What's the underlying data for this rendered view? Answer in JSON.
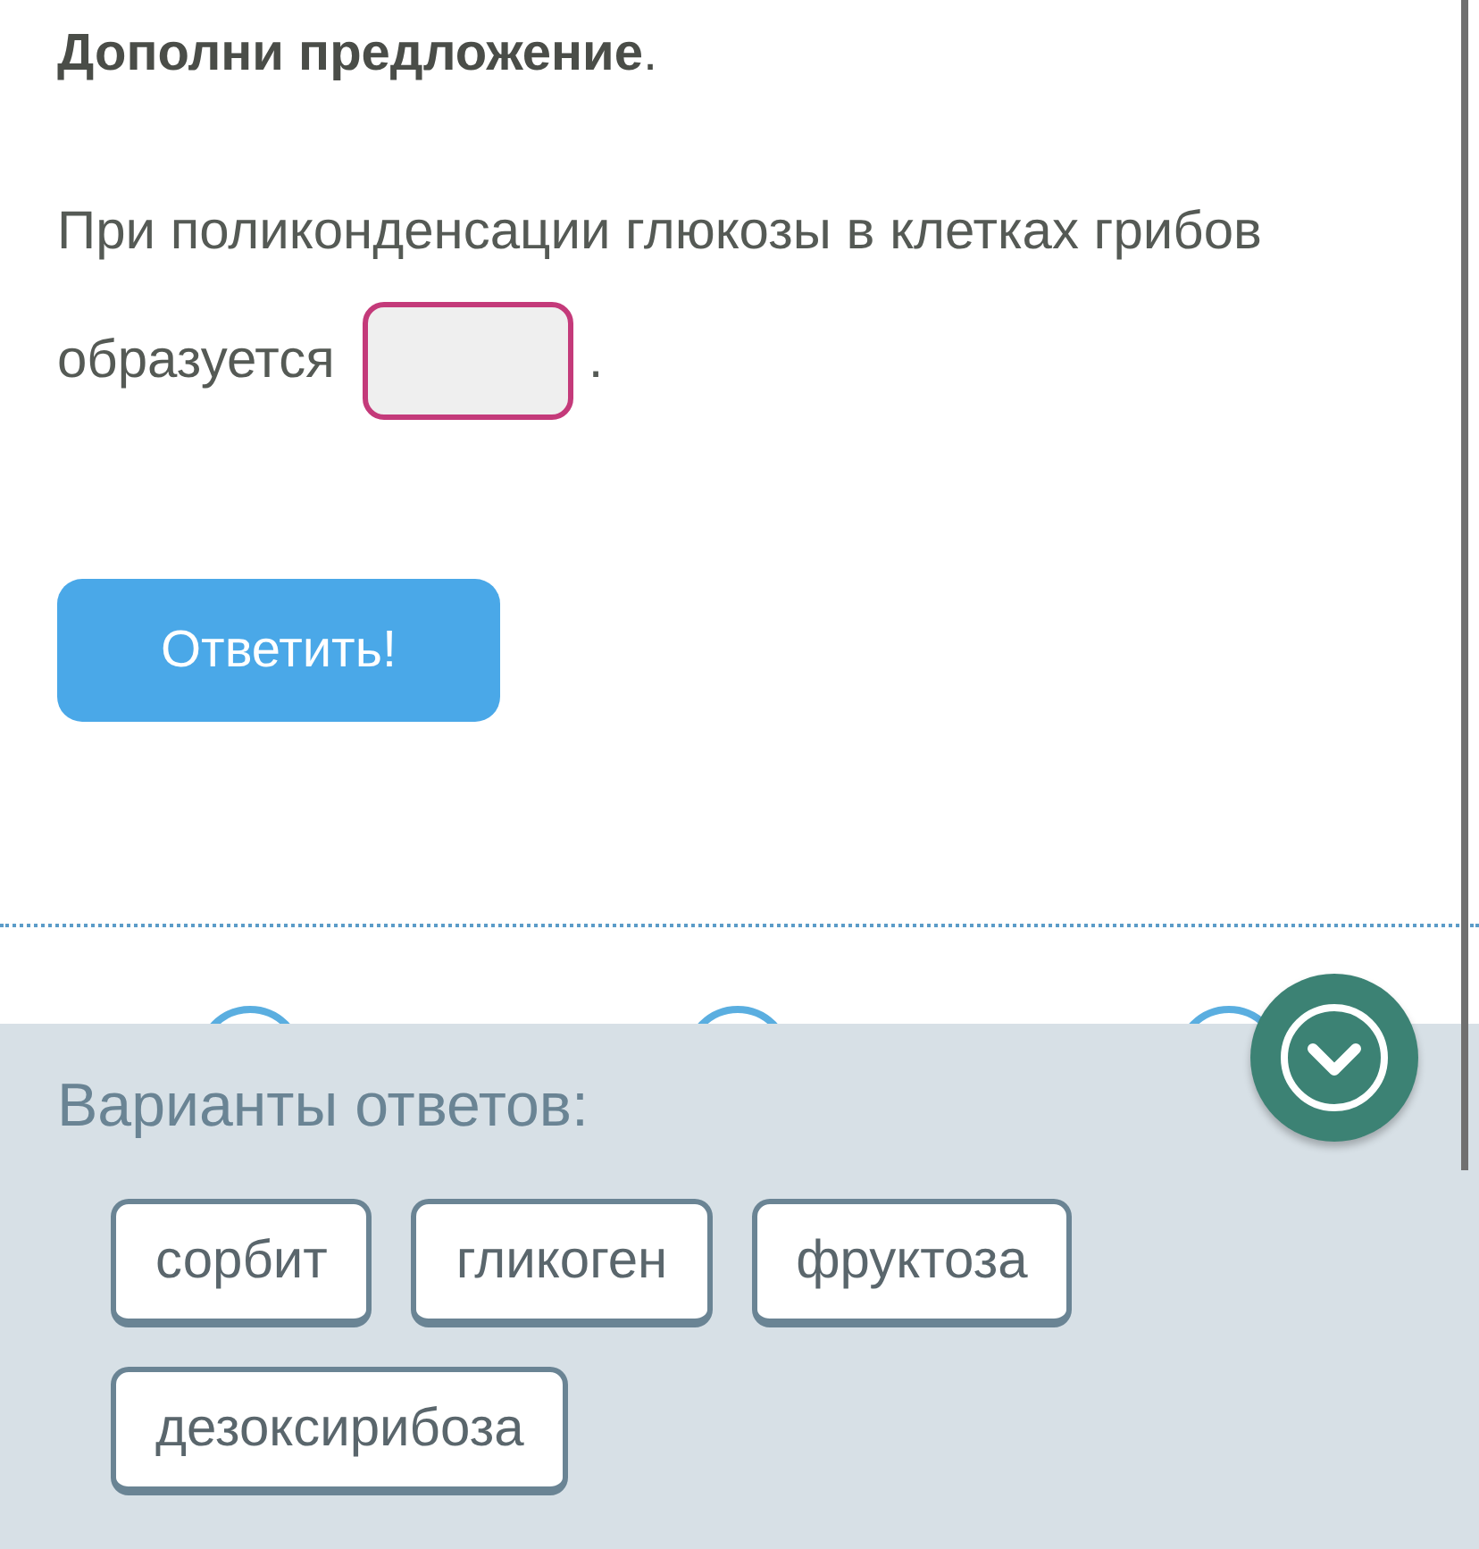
{
  "instruction": "**Дополни предложение**.",
  "sentence": {
    "lines": [
      "При поликонденсации глюкозы в клетках грибов",
      "образуется"
    ],
    "ending": "."
  },
  "submit_button": "Ответить!",
  "options_title": "Варианты ответов:",
  "options": [
    "сорбит",
    "гликоген",
    "фруктоза",
    "дезоксирибоза"
  ]
}
